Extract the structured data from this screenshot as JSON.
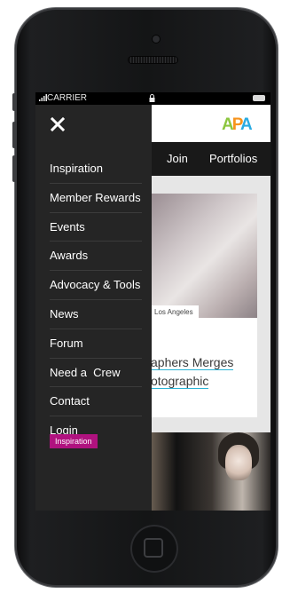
{
  "status_bar": {
    "carrier": "CARRIER"
  },
  "site": {
    "logo": "APA",
    "nav": [
      "Join",
      "Portfolios"
    ],
    "card": {
      "tag": "Los Angeles",
      "title": "aphers Merges otographic"
    }
  },
  "menu": {
    "close_icon": "close-icon",
    "items": [
      "Inspiration",
      "Member Rewards",
      "Events",
      "Awards",
      "Advocacy & Tools",
      "News",
      "Forum",
      "Need a  Crew",
      "Contact",
      "Login"
    ],
    "badge": "Inspiration"
  },
  "colors": {
    "menu_bg": "#252525",
    "nav_bg": "#191919",
    "badge": "#b0127f",
    "link_underline": "#2ab3d6"
  }
}
